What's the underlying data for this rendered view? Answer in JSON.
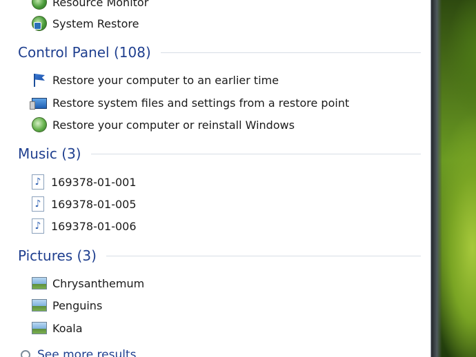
{
  "programs": [
    {
      "label": "Resource Monitor",
      "icon": "resource-monitor-icon"
    },
    {
      "label": "System Restore",
      "icon": "system-restore-icon"
    }
  ],
  "categories": {
    "control_panel": {
      "title": "Control Panel (108)",
      "items": [
        {
          "label": "Restore your computer to an earlier time",
          "icon": "flag-icon"
        },
        {
          "label": "Restore system files and settings from a restore point",
          "icon": "computer-screen-icon"
        },
        {
          "label": "Restore your computer or reinstall Windows",
          "icon": "recovery-icon"
        }
      ]
    },
    "music": {
      "title": "Music (3)",
      "items": [
        {
          "label": "169378-01-001",
          "icon": "music-file-icon"
        },
        {
          "label": "169378-01-005",
          "icon": "music-file-icon"
        },
        {
          "label": "169378-01-006",
          "icon": "music-file-icon"
        }
      ]
    },
    "pictures": {
      "title": "Pictures (3)",
      "items": [
        {
          "label": "Chrysanthemum",
          "icon": "picture-file-icon"
        },
        {
          "label": "Penguins",
          "icon": "picture-file-icon"
        },
        {
          "label": "Koala",
          "icon": "picture-file-icon"
        }
      ]
    }
  },
  "see_more": {
    "label": "See more results",
    "icon": "search-icon"
  },
  "colors": {
    "category_text": "#1f3f8f",
    "item_text": "#1a1a1a",
    "panel_bg": "#ffffff",
    "divider": "#d7dde5"
  }
}
